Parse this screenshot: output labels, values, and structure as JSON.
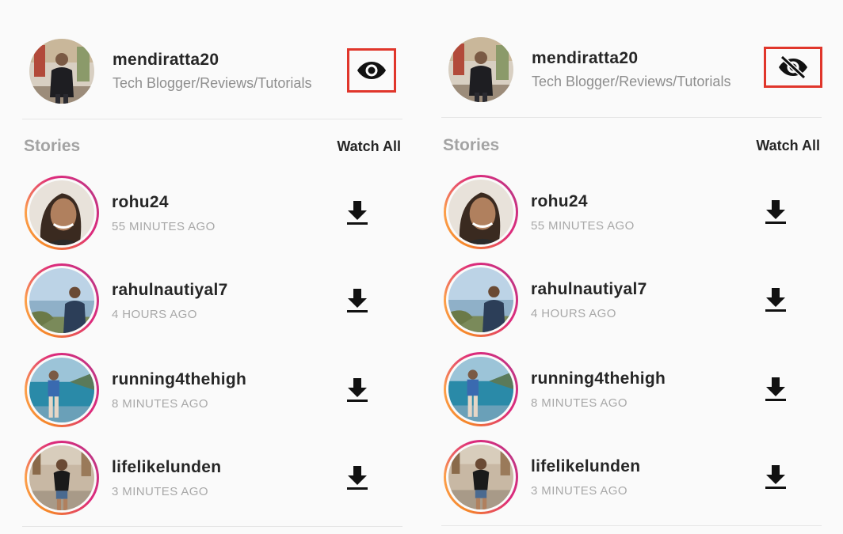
{
  "colors": {
    "highlight_border": "#e0362b",
    "muted_text": "#8e8e8e",
    "story_ring": [
      "#f58529",
      "#dd2a7b",
      "#c13584"
    ]
  },
  "panels": [
    {
      "profile": {
        "username": "mendiratta20",
        "bio": "Tech Blogger/Reviews/Tutorials",
        "toggle_icon": "eye-icon"
      },
      "stories_title": "Stories",
      "watch_all": "Watch All",
      "stories": [
        {
          "username": "rohu24",
          "time": "55 MINUTES AGO"
        },
        {
          "username": "rahulnautiyal7",
          "time": "4 HOURS AGO"
        },
        {
          "username": "running4thehigh",
          "time": "8 MINUTES AGO"
        },
        {
          "username": "lifelikelunden",
          "time": "3 MINUTES AGO"
        }
      ]
    },
    {
      "profile": {
        "username": "mendiratta20",
        "bio": "Tech Blogger/Reviews/Tutorials",
        "toggle_icon": "eye-off-icon"
      },
      "stories_title": "Stories",
      "watch_all": "Watch All",
      "stories": [
        {
          "username": "rohu24",
          "time": "55 MINUTES AGO"
        },
        {
          "username": "rahulnautiyal7",
          "time": "4 HOURS AGO"
        },
        {
          "username": "running4thehigh",
          "time": "8 MINUTES AGO"
        },
        {
          "username": "lifelikelunden",
          "time": "3 MINUTES AGO"
        }
      ]
    }
  ]
}
